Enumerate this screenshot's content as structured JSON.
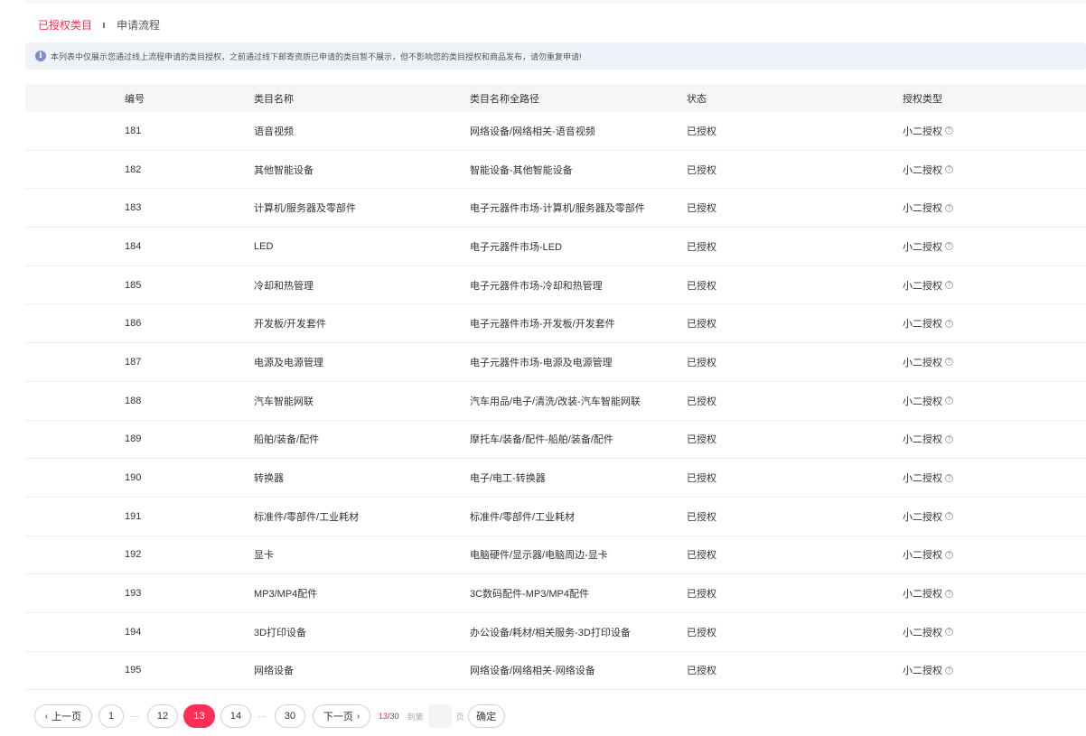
{
  "tabs": [
    {
      "label": "已授权类目",
      "active": true
    },
    {
      "label": "申请流程",
      "active": false
    }
  ],
  "notice": {
    "icon": "info-icon",
    "text": "本列表中仅展示您通过线上流程申请的类目授权，之前通过线下邮寄资质已申请的类目暂不展示，但不影响您的类目授权和商品发布，请勿重复申请!"
  },
  "table": {
    "columns": [
      "编号",
      "类目名称",
      "类目名称全路径",
      "状态",
      "授权类型"
    ],
    "rows": [
      {
        "id": "181",
        "name": "语音视频",
        "path": "网络设备/网络相关-语音视频",
        "status": "已授权",
        "type": "小二授权"
      },
      {
        "id": "182",
        "name": "其他智能设备",
        "path": "智能设备-其他智能设备",
        "status": "已授权",
        "type": "小二授权"
      },
      {
        "id": "183",
        "name": "计算机/服务器及零部件",
        "path": "电子元器件市场-计算机/服务器及零部件",
        "status": "已授权",
        "type": "小二授权"
      },
      {
        "id": "184",
        "name": "LED",
        "path": "电子元器件市场-LED",
        "status": "已授权",
        "type": "小二授权"
      },
      {
        "id": "185",
        "name": "冷却和热管理",
        "path": "电子元器件市场-冷却和热管理",
        "status": "已授权",
        "type": "小二授权"
      },
      {
        "id": "186",
        "name": "开发板/开发套件",
        "path": "电子元器件市场-开发板/开发套件",
        "status": "已授权",
        "type": "小二授权"
      },
      {
        "id": "187",
        "name": "电源及电源管理",
        "path": "电子元器件市场-电源及电源管理",
        "status": "已授权",
        "type": "小二授权"
      },
      {
        "id": "188",
        "name": "汽车智能网联",
        "path": "汽车用品/电子/清洗/改装-汽车智能网联",
        "status": "已授权",
        "type": "小二授权"
      },
      {
        "id": "189",
        "name": "船舶/装备/配件",
        "path": "摩托车/装备/配件-船舶/装备/配件",
        "status": "已授权",
        "type": "小二授权"
      },
      {
        "id": "190",
        "name": "转换器",
        "path": "电子/电工-转换器",
        "status": "已授权",
        "type": "小二授权"
      },
      {
        "id": "191",
        "name": "标准件/零部件/工业耗材",
        "path": "标准件/零部件/工业耗材",
        "status": "已授权",
        "type": "小二授权"
      },
      {
        "id": "192",
        "name": "显卡",
        "path": "电脑硬件/显示器/电脑周边-显卡",
        "status": "已授权",
        "type": "小二授权"
      },
      {
        "id": "193",
        "name": "MP3/MP4配件",
        "path": "3C数码配件-MP3/MP4配件",
        "status": "已授权",
        "type": "小二授权"
      },
      {
        "id": "194",
        "name": "3D打印设备",
        "path": "办公设备/耗材/相关服务-3D打印设备",
        "status": "已授权",
        "type": "小二授权"
      },
      {
        "id": "195",
        "name": "网络设备",
        "path": "网络设备/网络相关-网络设备",
        "status": "已授权",
        "type": "小二授权"
      }
    ]
  },
  "pagination": {
    "prev_label": "上一页",
    "next_label": "下一页",
    "prev_icon": "chevron-left-icon",
    "next_icon": "chevron-right-icon",
    "pages": [
      "1",
      "12",
      "13",
      "14",
      "30"
    ],
    "ellipsis": "···",
    "current": "13",
    "total": "30",
    "goto_prefix": "到第",
    "goto_suffix": "页",
    "goto_value": "",
    "confirm_label": "确定"
  },
  "colors": {
    "accent": "#ff2e54",
    "notice_bg": "#f0f2f9",
    "header_bg": "#f5f6f8"
  }
}
